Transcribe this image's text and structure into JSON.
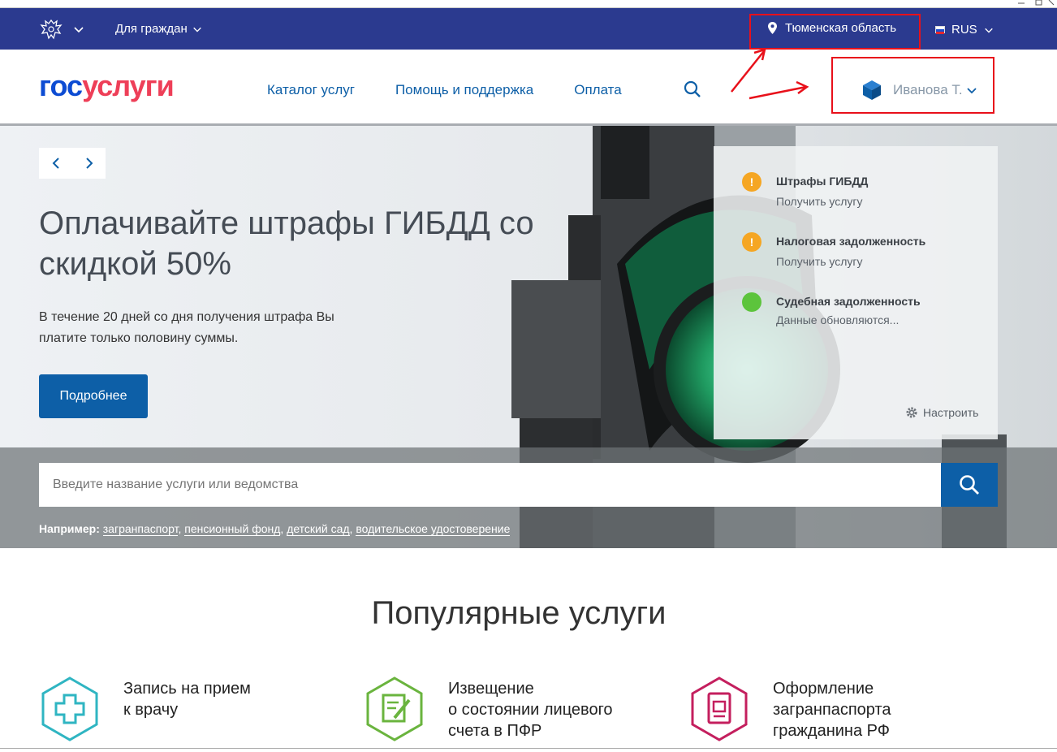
{
  "topbar": {
    "citizens_label": "Для граждан",
    "region_label": "Тюменская область",
    "lang_label": "RUS"
  },
  "header": {
    "logo_part1": "гос",
    "logo_part2": "услуги",
    "nav": [
      "Каталог услуг",
      "Помощь и поддержка",
      "Оплата"
    ],
    "user_name": "Иванова Т."
  },
  "hero": {
    "title": "Оплачивайте штрафы ГИБДД со скидкой 50%",
    "text": "В течение 20 дней со дня получения штрафа Вы платите только половину суммы.",
    "button": "Подробнее"
  },
  "panel": {
    "items": [
      {
        "title": "Штрафы ГИБДД",
        "sub": "Получить услугу",
        "status": "warning",
        "color": "#f5a623"
      },
      {
        "title": "Налоговая задолженность",
        "sub": "Получить услугу",
        "status": "warning",
        "color": "#f5a623"
      },
      {
        "title": "Судебная задолженность",
        "sub": "Данные обновляются...",
        "status": "ok",
        "color": "#5cc43c"
      }
    ],
    "setup_label": "Настроить"
  },
  "search": {
    "placeholder": "Введите название услуги или ведомства",
    "examples_label": "Например:",
    "examples": [
      "загранпаспорт",
      "пенсионный фонд",
      "детский сад",
      "водительское удостоверение"
    ]
  },
  "popular": {
    "title": "Популярные услуги",
    "services": [
      {
        "label_line1": "Запись на прием",
        "label_line2": "к врачу",
        "label_line3": "",
        "icon": "medical-cross-icon",
        "color": "#2fb5c2"
      },
      {
        "label_line1": "Извещение",
        "label_line2": "о состоянии лицевого",
        "label_line3": "счета в ПФР",
        "icon": "document-edit-icon",
        "color": "#6ab43e"
      },
      {
        "label_line1": "Оформление",
        "label_line2": "загранпаспорта",
        "label_line3": "гражданина РФ",
        "icon": "passport-icon",
        "color": "#c41f5e"
      }
    ]
  },
  "colors": {
    "topbar": "#2b3a8f",
    "accent": "#0d5fa7",
    "logo_blue": "#0d4cd3",
    "logo_red": "#ee3f58",
    "annotation": "#e8101a"
  }
}
